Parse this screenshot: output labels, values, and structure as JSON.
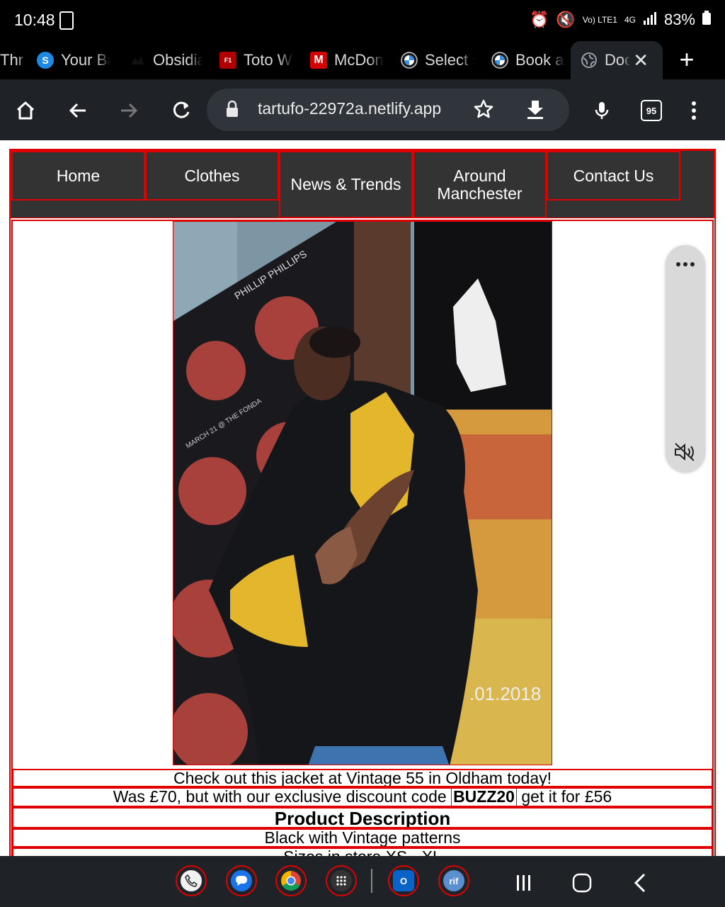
{
  "status": {
    "time": "10:48",
    "battery": "83%",
    "volte": "Vo) LTE1",
    "network": "4G"
  },
  "tabs": [
    {
      "title": "Thr",
      "icon": "thread-icon"
    },
    {
      "title": "Your Ba",
      "icon": "s-logo-icon"
    },
    {
      "title": "Obsidia",
      "icon": "obsidian-icon"
    },
    {
      "title": "Toto W",
      "icon": "f1-icon"
    },
    {
      "title": "McDon",
      "icon": "mcdonalds-icon"
    },
    {
      "title": "Select s",
      "icon": "bmw-icon"
    },
    {
      "title": "Book a",
      "icon": "bmw-icon"
    },
    {
      "title": "Doc",
      "icon": "globe-icon"
    }
  ],
  "toolbar": {
    "url": "tartufo-22972a.netlify.app",
    "tab_count": "95"
  },
  "nav": [
    "Home",
    "Clothes",
    "News & Trends",
    "Around Manchester",
    "Contact Us"
  ],
  "product": {
    "line1": "Check out this jacket at Vintage 55 in Oldham today!",
    "line2_before": "Was £70, but with our exclusive discount code ",
    "code": "BUZZ20",
    "line2_after": " get it for £56",
    "heading": "Product Description",
    "line3": "Black with Vintage patterns",
    "line4": "Sizes in store XS - XL"
  },
  "photo": {
    "poster_text": "PHILLIP PHILLIPS",
    "poster_date": "MARCH 21 @ THE FONDA",
    "year_text": ".01.2018",
    "icon": "photo-jacket-model"
  },
  "colors": {
    "nav_bg": "#333333",
    "outline": "#e00000",
    "chrome_bg": "#1f2328"
  }
}
